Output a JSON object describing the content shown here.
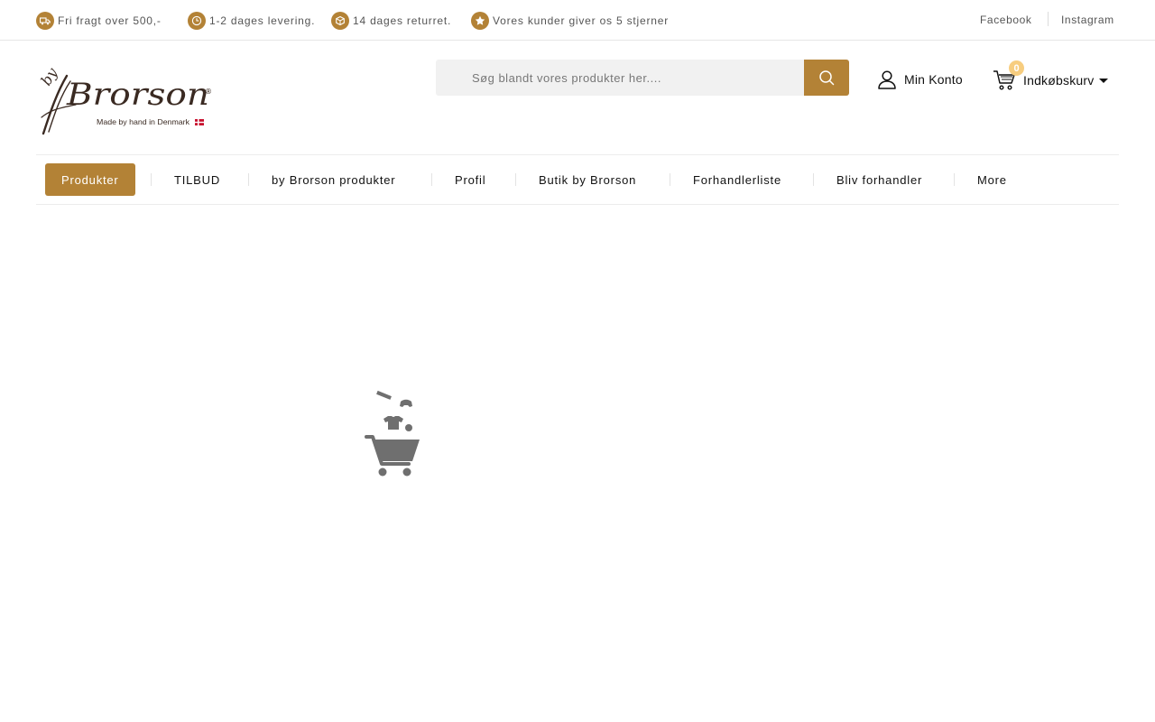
{
  "topbar": {
    "usps": [
      {
        "icon": "truck-icon",
        "label": "Fri fragt over 500,-"
      },
      {
        "icon": "clock-icon",
        "label": "1-2 dages levering."
      },
      {
        "icon": "box-icon",
        "label": "14 dages returret."
      },
      {
        "icon": "star-icon",
        "label": "Vores kunder giver os 5 stjerner"
      }
    ],
    "social": {
      "facebook": "Facebook",
      "instagram": "Instagram"
    }
  },
  "header": {
    "logo": {
      "word": "Brorson",
      "prefix": "by",
      "tagline": "Made by hand in Denmark",
      "mark": "®"
    },
    "search": {
      "placeholder": "Søg blandt vores produkter her...."
    },
    "account_label": "Min Konto",
    "cart": {
      "count": "0",
      "label": "Indkøbskurv"
    }
  },
  "nav": {
    "items": [
      {
        "label": "Produkter",
        "active": true
      },
      {
        "label": "TILBUD"
      },
      {
        "label": "by Brorson produkter"
      },
      {
        "label": "Profil"
      },
      {
        "label": "Butik by Brorson"
      },
      {
        "label": "Forhandlerliste"
      },
      {
        "label": "Bliv forhandler"
      },
      {
        "label": "More"
      }
    ]
  },
  "colors": {
    "accent": "#b38236",
    "badge": "#f7cd7f",
    "loader": "#6f6f6f"
  },
  "loader": {
    "icon": "shopping-cart-loading-icon"
  }
}
